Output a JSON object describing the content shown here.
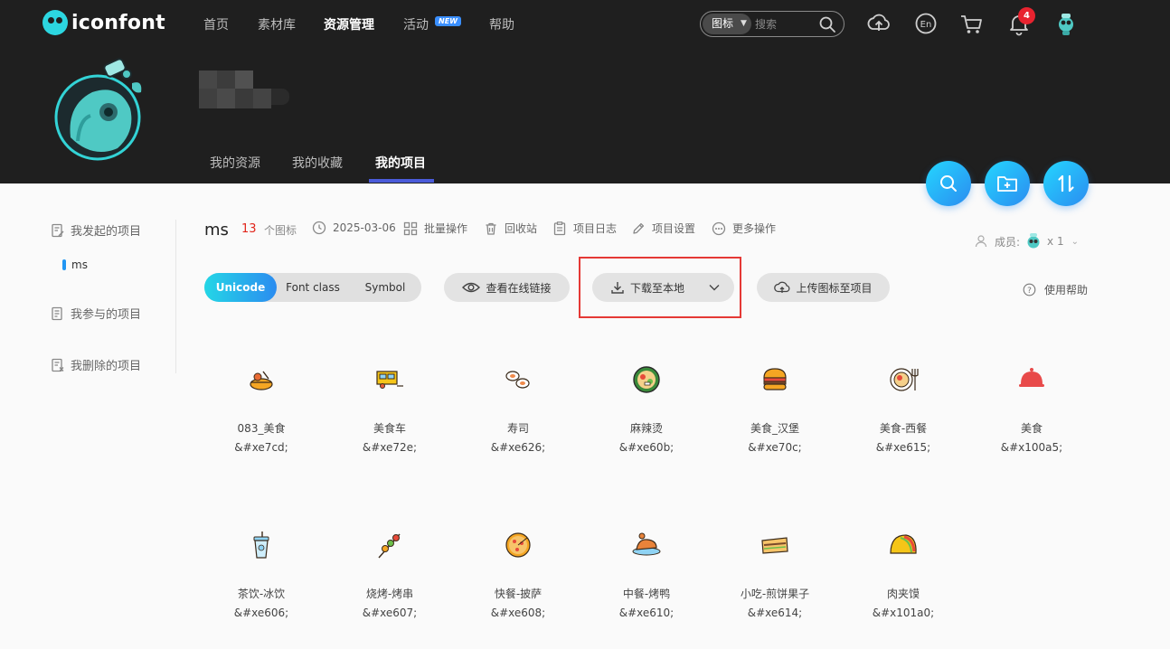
{
  "brand": {
    "name": "iconfont"
  },
  "nav": {
    "items": [
      {
        "label": "首页"
      },
      {
        "label": "素材库"
      },
      {
        "label": "资源管理"
      },
      {
        "label": "活动"
      },
      {
        "label": "帮助"
      }
    ],
    "new_badge": "NEW"
  },
  "search": {
    "type_label": "图标",
    "placeholder": "搜索"
  },
  "header_icons": {
    "notifications_count": "4"
  },
  "tabs": [
    {
      "label": "我的资源"
    },
    {
      "label": "我的收藏"
    },
    {
      "label": "我的项目"
    }
  ],
  "sidebar": {
    "created": "我发起的项目",
    "sub_item": "ms",
    "joined": "我参与的项目",
    "deleted": "我删除的项目"
  },
  "project": {
    "name": "ms",
    "count": "13",
    "count_label": "个图标",
    "date": "2025-03-06",
    "actions": {
      "batch": "批量操作",
      "recycle": "回收站",
      "log": "项目日志",
      "settings": "项目设置",
      "more": "更多操作"
    },
    "members_label": "成员:",
    "members_count": "x 1"
  },
  "toolbar": {
    "modes": [
      "Unicode",
      "Font class",
      "Symbol"
    ],
    "view_link": "查看在线链接",
    "download": "下载至本地",
    "upload": "上传图标至项目",
    "help": "使用帮助"
  },
  "icons": [
    {
      "name": "083_美食",
      "code": "&#xe7cd;"
    },
    {
      "name": "美食车",
      "code": "&#xe72e;"
    },
    {
      "name": "寿司",
      "code": "&#xe626;"
    },
    {
      "name": "麻辣烫",
      "code": "&#xe60b;"
    },
    {
      "name": "美食_汉堡",
      "code": "&#xe70c;"
    },
    {
      "name": "美食-西餐",
      "code": "&#xe615;"
    },
    {
      "name": "美食",
      "code": "&#x100a5;"
    },
    {
      "name": "茶饮-冰饮",
      "code": "&#xe606;"
    },
    {
      "name": "烧烤-烤串",
      "code": "&#xe607;"
    },
    {
      "name": "快餐-披萨",
      "code": "&#xe608;"
    },
    {
      "name": "中餐-烤鸭",
      "code": "&#xe610;"
    },
    {
      "name": "小吃-煎饼果子",
      "code": "&#xe614;"
    },
    {
      "name": "肉夹馍",
      "code": "&#x101a0;"
    }
  ],
  "colors": {
    "header_bg": "#1f1f1f",
    "accent": "#2b8cf0",
    "count_red": "#e1251b",
    "highlight_red": "#e53935"
  }
}
